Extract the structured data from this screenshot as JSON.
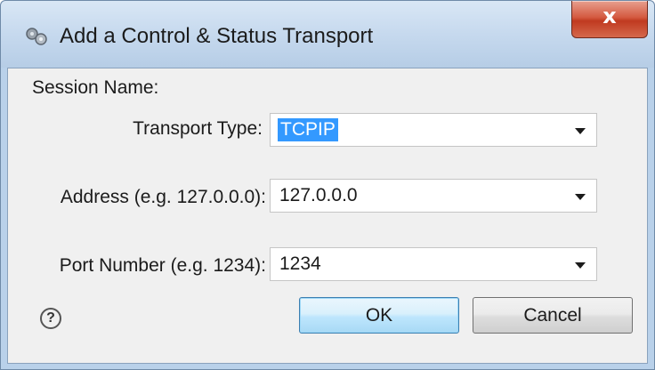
{
  "window": {
    "title": "Add a Control & Status Transport",
    "close_label": "x"
  },
  "form": {
    "session_label": "Session Name:",
    "transport_type": {
      "label": "Transport Type:",
      "value": "TCPIP"
    },
    "address": {
      "label": "Address (e.g. 127.0.0.0):",
      "value": "127.0.0.0"
    },
    "port": {
      "label": "Port Number (e.g. 1234):",
      "value": "1234"
    }
  },
  "buttons": {
    "help_glyph": "?",
    "ok_label": "OK",
    "cancel_label": "Cancel"
  },
  "icons": {
    "app": "gear-cluster-icon",
    "help": "help-circle-icon",
    "dropdown": "chevron-down-icon"
  }
}
